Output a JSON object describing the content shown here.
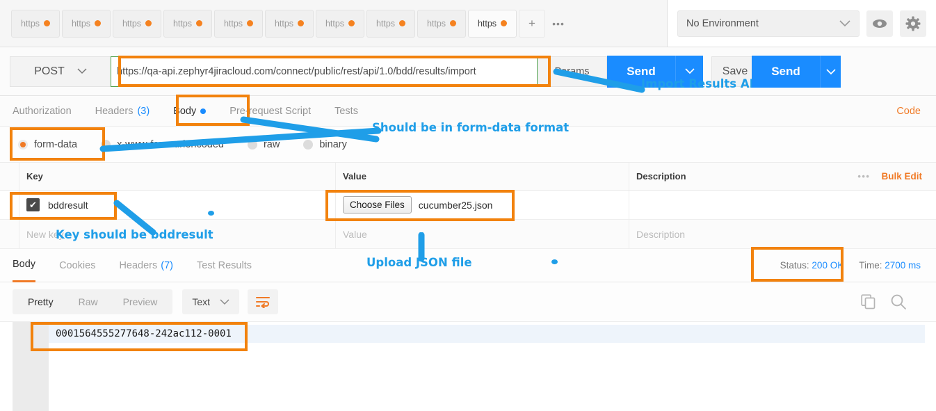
{
  "window": {
    "request_tabs": [
      {
        "label": "https",
        "unsaved": true,
        "active": false
      },
      {
        "label": "https",
        "unsaved": true,
        "active": false
      },
      {
        "label": "https",
        "unsaved": true,
        "active": false
      },
      {
        "label": "https",
        "unsaved": true,
        "active": false
      },
      {
        "label": "https",
        "unsaved": true,
        "active": false
      },
      {
        "label": "https",
        "unsaved": true,
        "active": false
      },
      {
        "label": "https",
        "unsaved": true,
        "active": false
      },
      {
        "label": "https",
        "unsaved": true,
        "active": false
      },
      {
        "label": "https",
        "unsaved": true,
        "active": false
      },
      {
        "label": "https",
        "unsaved": true,
        "active": true
      }
    ],
    "new_tab_label": "+",
    "tab_more_label": "•••"
  },
  "environment": {
    "selected": "No Environment",
    "chevron": "chevron-down-icon",
    "eye_icon": "eye-icon",
    "gear_icon": "gear-icon"
  },
  "request": {
    "method": "POST",
    "url": "https://qa-api.zephyr4jiracloud.com/connect/public/rest/api/1.0/bdd/results/import",
    "params_label": "Params",
    "send_label": "Send",
    "save_label": "Save",
    "tabs": [
      {
        "label": "Authorization",
        "count": "",
        "active": false,
        "dot": false
      },
      {
        "label": "Headers",
        "count": "(3)",
        "active": false,
        "dot": false
      },
      {
        "label": "Body",
        "count": "",
        "active": true,
        "dot": true
      },
      {
        "label": "Pre-request Script",
        "count": "",
        "active": false,
        "dot": false
      },
      {
        "label": "Tests",
        "count": "",
        "active": false,
        "dot": false
      }
    ],
    "code_link": "Code",
    "body_types": [
      {
        "label": "form-data",
        "selected": true
      },
      {
        "label": "x-www-form-urlencoded",
        "selected": false
      },
      {
        "label": "raw",
        "selected": false
      },
      {
        "label": "binary",
        "selected": false
      }
    ],
    "table": {
      "headers": {
        "key": "Key",
        "value": "Value",
        "description": "Description",
        "more": "•••",
        "bulk_edit": "Bulk Edit"
      },
      "rows": [
        {
          "checked": true,
          "check_glyph": "✔",
          "key": "bddresult",
          "value_button": "Choose Files",
          "value_file": "cucumber25.json",
          "description": ""
        }
      ],
      "empty_row": {
        "key_placeholder": "New key",
        "value_placeholder": "Value",
        "description_placeholder": "Description"
      }
    }
  },
  "response": {
    "tabs": [
      {
        "label": "Body",
        "count": "",
        "active": true
      },
      {
        "label": "Cookies",
        "count": "",
        "active": false
      },
      {
        "label": "Headers",
        "count": "(7)",
        "active": false
      },
      {
        "label": "Test Results",
        "count": "",
        "active": false
      }
    ],
    "status_label": "Status:",
    "status_value": "200 OK",
    "time_label": "Time:",
    "time_value": "2700 ms",
    "view_modes": [
      {
        "label": "Pretty",
        "active": true
      },
      {
        "label": "Raw",
        "active": false
      },
      {
        "label": "Preview",
        "active": false
      }
    ],
    "format": "Text",
    "format_chevron": "chevron-down-icon",
    "wrap_icon": "word-wrap-icon",
    "copy_icon": "copy-icon",
    "search_icon": "search-icon",
    "body_text": "0001564555277648-242ac112-0001"
  },
  "annotations": [
    {
      "id": "import-results-api",
      "text": "Import Results API"
    },
    {
      "id": "form-data-format",
      "text": "Should be in form-data format"
    },
    {
      "id": "key-bddresult",
      "text": "Key should be bddresult"
    },
    {
      "id": "upload-json",
      "text": "Upload JSON file"
    }
  ],
  "colors": {
    "highlight": "#f2820d",
    "annotation": "#1f9ee8",
    "accent_orange": "#f07a26",
    "accent_blue": "#1a8cff"
  }
}
